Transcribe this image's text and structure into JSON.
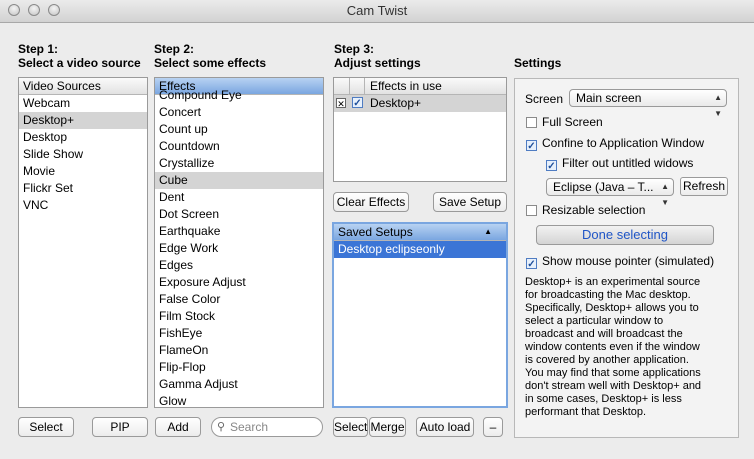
{
  "window": {
    "title": "Cam Twist"
  },
  "step1": {
    "heading_line1": "Step 1:",
    "heading_line2": "Select a video source",
    "list_header": "Video Sources",
    "items": [
      "Webcam",
      "Desktop+",
      "Desktop",
      "Slide Show",
      "Movie",
      "Flickr Set",
      "VNC"
    ],
    "selected": "Desktop+",
    "select_button": "Select",
    "pip_button": "PIP"
  },
  "step2": {
    "heading_line1": "Step 2:",
    "heading_line2": "Select some effects",
    "list_header": "Effects",
    "items": [
      "Compound Eye",
      "Concert",
      "Count up",
      "Countdown",
      "Crystallize",
      "Cube",
      "Dent",
      "Dot Screen",
      "Earthquake",
      "Edge Work",
      "Edges",
      "Exposure Adjust",
      "False Color",
      "Film Stock",
      "FishEye",
      "FlameOn",
      "Flip-Flop",
      "Gamma Adjust",
      "Glow"
    ],
    "selected": "Cube",
    "add_button": "Add",
    "search_placeholder": "Search"
  },
  "step3": {
    "heading_line1": "Step 3:",
    "heading_line2": "Adjust settings",
    "effects_header": "Effects in use",
    "effects_in_use": [
      "Desktop+"
    ],
    "remove_glyph": "✕",
    "check_glyph": "✓",
    "clear_button": "Clear Effects",
    "save_button": "Save Setup",
    "saved_header": "Saved Setups",
    "saved_items": [
      "Desktop eclipseonly"
    ],
    "select_button": "Select",
    "merge_button": "Merge",
    "autoload_button": "Auto load",
    "minus_button": "–"
  },
  "settings": {
    "heading": "Settings",
    "screen_label": "Screen",
    "screen_value": "Main screen",
    "full_screen": "Full Screen",
    "full_screen_checked": false,
    "confine": "Confine to Application Window",
    "confine_checked": true,
    "filter": "Filter out untitled widows",
    "filter_checked": true,
    "window_value": "Eclipse (Java – T...",
    "refresh_button": "Refresh",
    "resizable": "Resizable selection",
    "resizable_checked": false,
    "done_button": "Done selecting",
    "pointer": "Show mouse pointer (simulated)",
    "pointer_checked": true,
    "description": [
      "Desktop+ is an experimental source",
      "for broadcasting the Mac desktop.",
      "Specifically, Desktop+ allows you to",
      "select a particular window to",
      "broadcast and will broadcast the",
      "window contents even if the window",
      "is covered by another application.",
      "You may find that some applications",
      "don't stream well with Desktop+ and",
      "in some cases, Desktop+ is less",
      "performant that Desktop."
    ]
  },
  "colors": {
    "selection_blue": "#3b75d6",
    "header_blue": "#7aa6e0"
  }
}
